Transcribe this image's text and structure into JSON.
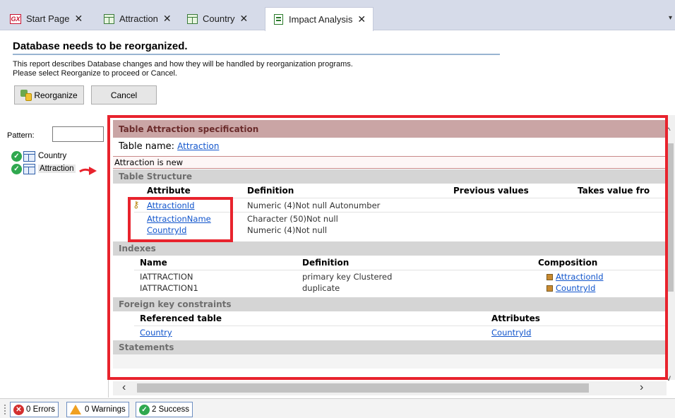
{
  "tabs": [
    {
      "label": "Start Page",
      "icon": "gx-icon"
    },
    {
      "label": "Attraction",
      "icon": "table-icon"
    },
    {
      "label": "Country",
      "icon": "table-icon"
    },
    {
      "label": "Impact Analysis",
      "icon": "document-icon",
      "active": true
    }
  ],
  "header": {
    "title": "Database needs to be reorganized.",
    "desc_line1": "This report describes Database changes and how they will be handled by reorganization programs.",
    "desc_line2": "Please select Reorganize to proceed or Cancel."
  },
  "buttons": {
    "reorganize": "Reorganize",
    "cancel": "Cancel"
  },
  "left": {
    "pattern_label": "Pattern:",
    "pattern_value": "",
    "items": [
      {
        "label": "Country",
        "status": "success"
      },
      {
        "label": "Attraction",
        "status": "success",
        "selected": true
      }
    ]
  },
  "report": {
    "spec_title": "Table Attraction specification",
    "table_name_label": "Table name:",
    "table_name_value": "Attraction",
    "is_new": "Attraction is new",
    "structure": {
      "title": "Table Structure",
      "columns": [
        "Attribute",
        "Definition",
        "Previous values",
        "Takes value fro"
      ],
      "rows": [
        {
          "attribute": "AttractionId",
          "definition": "Numeric (4)Not null Autonumber",
          "key": true
        },
        {
          "attribute": "AttractionName",
          "definition": "Character (50)Not null"
        },
        {
          "attribute": "CountryId",
          "definition": "Numeric (4)Not null"
        }
      ]
    },
    "indexes": {
      "title": "Indexes",
      "columns": [
        "Name",
        "Definition",
        "Composition"
      ],
      "rows": [
        {
          "name": "IATTRACTION",
          "definition": "primary key Clustered",
          "composition": "AttractionId"
        },
        {
          "name": "IATTRACTION1",
          "definition": "duplicate",
          "composition": "CountryId"
        }
      ]
    },
    "fk": {
      "title": "Foreign key constraints",
      "columns": [
        "Referenced table",
        "Attributes"
      ],
      "rows": [
        {
          "table": "Country",
          "attributes": "CountryId"
        }
      ]
    },
    "statements": {
      "title": "Statements"
    }
  },
  "status": {
    "errors": "0 Errors",
    "warnings": "0 Warnings",
    "success": "2 Success"
  },
  "colors": {
    "annotation": "#e8232d",
    "link": "#1155cc",
    "spec_header": "#caa5a5"
  }
}
